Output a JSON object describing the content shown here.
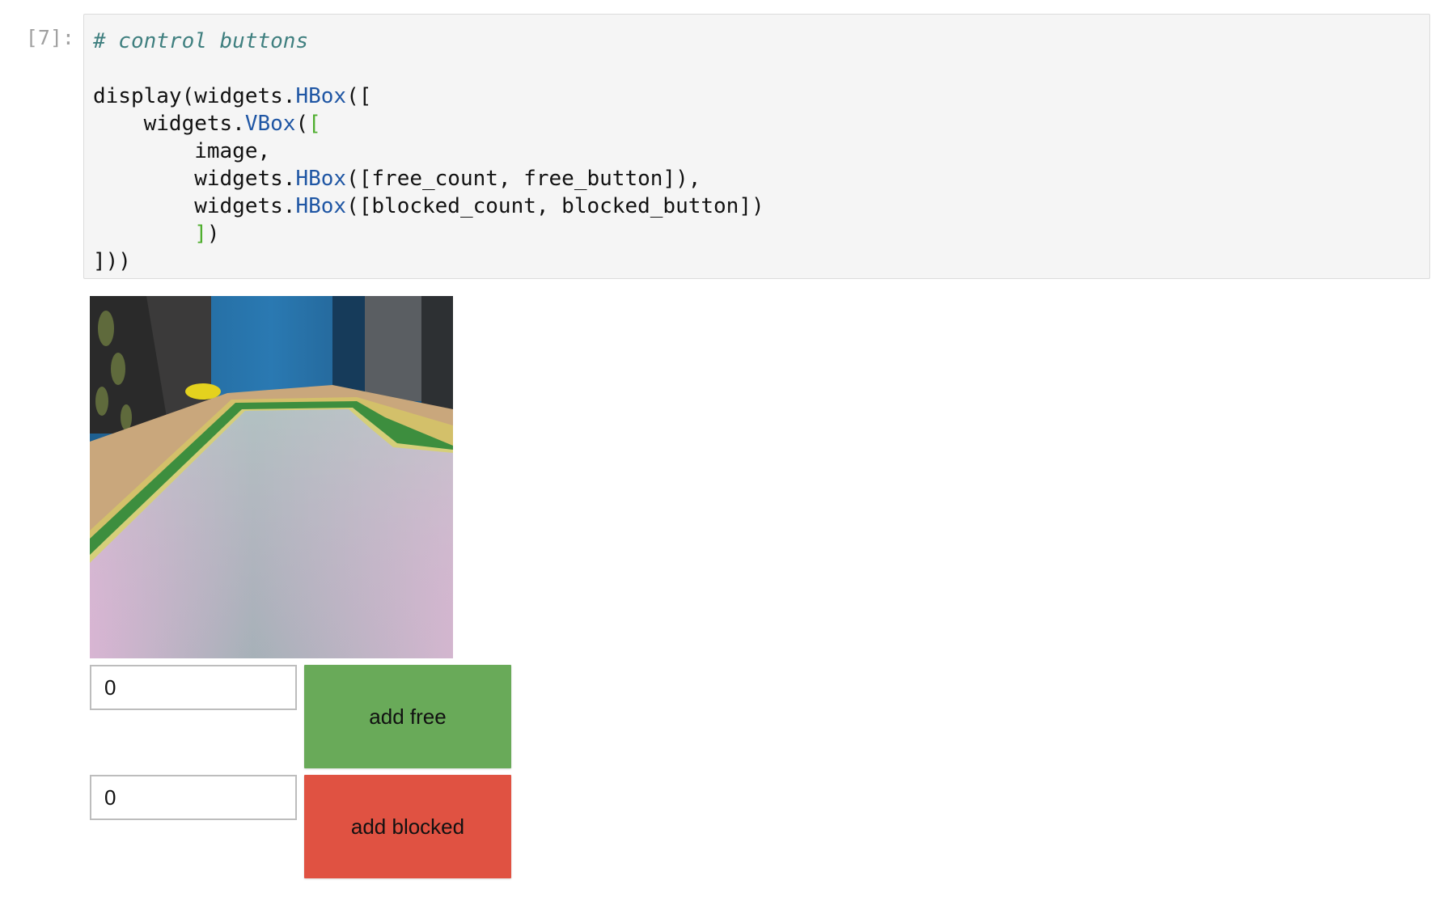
{
  "cell": {
    "prompt": "[7]:",
    "code_lines": [
      {
        "parts": [
          {
            "cls": "comment",
            "text": "# control buttons"
          }
        ]
      },
      {
        "parts": [
          {
            "cls": "",
            "text": ""
          }
        ]
      },
      {
        "parts": [
          {
            "cls": "",
            "text": "display(widgets."
          },
          {
            "cls": "attr",
            "text": "HBox"
          },
          {
            "cls": "",
            "text": "(["
          }
        ]
      },
      {
        "parts": [
          {
            "cls": "",
            "text": "    widgets."
          },
          {
            "cls": "attr",
            "text": "VBox"
          },
          {
            "cls": "",
            "text": "("
          },
          {
            "cls": "bracket-green",
            "text": "["
          }
        ]
      },
      {
        "parts": [
          {
            "cls": "",
            "text": "        image,"
          }
        ]
      },
      {
        "parts": [
          {
            "cls": "",
            "text": "        widgets."
          },
          {
            "cls": "attr",
            "text": "HBox"
          },
          {
            "cls": "",
            "text": "([free_count, free_button]),"
          }
        ]
      },
      {
        "parts": [
          {
            "cls": "",
            "text": "        widgets."
          },
          {
            "cls": "attr",
            "text": "HBox"
          },
          {
            "cls": "",
            "text": "([blocked_count, blocked_button])"
          }
        ]
      },
      {
        "parts": [
          {
            "cls": "",
            "text": "        "
          },
          {
            "cls": "bracket-green",
            "text": "]"
          },
          {
            "cls": "",
            "text": ")"
          }
        ]
      },
      {
        "parts": [
          {
            "cls": "",
            "text": "]))"
          }
        ]
      }
    ]
  },
  "widgets": {
    "free_count": {
      "value": "0"
    },
    "free_button": {
      "label": "add free",
      "color": "#69aa59"
    },
    "blocked_count": {
      "value": "0"
    },
    "blocked_button": {
      "label": "add blocked",
      "color": "#e05242"
    }
  },
  "colors": {
    "cell_background": "#f5f5f5",
    "comment": "#3f7f7f",
    "attribute": "#1f56a4",
    "bracket": "#4fae2e"
  }
}
